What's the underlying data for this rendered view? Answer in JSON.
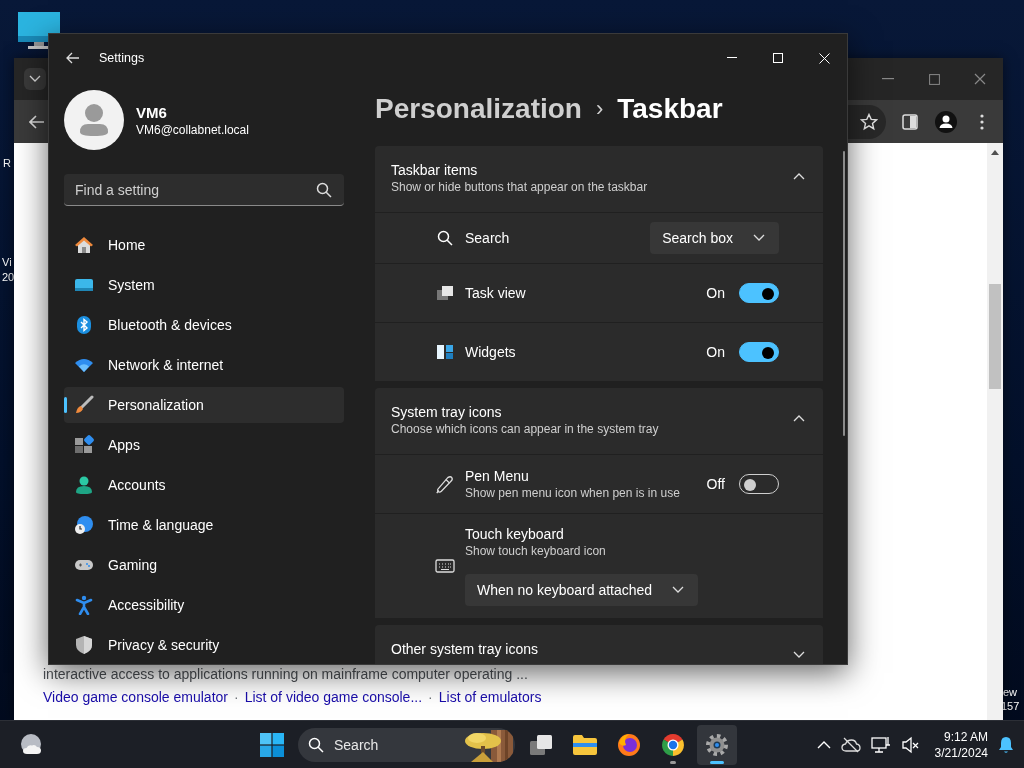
{
  "desktop": {
    "edge_texts": [
      "R",
      "Vi",
      "20",
      "ew",
      "157"
    ]
  },
  "browser": {
    "result": {
      "snippet": "interactive access to applications running on mainframe computer operating ...",
      "separator": "·",
      "links": [
        "Video game console emulator",
        "List of video game console...",
        "List of emulators"
      ]
    }
  },
  "settings": {
    "title": "Settings",
    "user": {
      "name": "VM6",
      "email": "VM6@collabnet.local"
    },
    "search": {
      "placeholder": "Find a setting"
    },
    "nav": [
      {
        "label": "Home",
        "selected": false
      },
      {
        "label": "System",
        "selected": false
      },
      {
        "label": "Bluetooth & devices",
        "selected": false
      },
      {
        "label": "Network & internet",
        "selected": false
      },
      {
        "label": "Personalization",
        "selected": true
      },
      {
        "label": "Apps",
        "selected": false
      },
      {
        "label": "Accounts",
        "selected": false
      },
      {
        "label": "Time & language",
        "selected": false
      },
      {
        "label": "Gaming",
        "selected": false
      },
      {
        "label": "Accessibility",
        "selected": false
      },
      {
        "label": "Privacy & security",
        "selected": false
      }
    ],
    "breadcrumb": {
      "parent": "Personalization",
      "separator": "›",
      "current": "Taskbar"
    },
    "sections": [
      {
        "title": "Taskbar items",
        "subtitle": "Show or hide buttons that appear on the taskbar",
        "expanded": true,
        "rows": [
          {
            "kind": "dropdown",
            "label": "Search",
            "value": "Search box"
          },
          {
            "kind": "toggle",
            "label": "Task view",
            "state_text": "On",
            "on": true
          },
          {
            "kind": "toggle",
            "label": "Widgets",
            "state_text": "On",
            "on": true
          }
        ]
      },
      {
        "title": "System tray icons",
        "subtitle": "Choose which icons can appear in the system tray",
        "expanded": true,
        "rows": [
          {
            "kind": "toggle",
            "label": "Pen Menu",
            "description": "Show pen menu icon when pen is in use",
            "state_text": "Off",
            "on": false
          },
          {
            "kind": "dropdown-below",
            "label": "Touch keyboard",
            "description": "Show touch keyboard icon",
            "value": "When no keyboard attached"
          }
        ]
      },
      {
        "title": "Other system tray icons",
        "expanded": false
      }
    ]
  },
  "taskbar": {
    "search": {
      "placeholder": "Search"
    },
    "apps": [
      {
        "running": false,
        "selected": false
      },
      {
        "running": false,
        "selected": false
      },
      {
        "running": false,
        "selected": false
      },
      {
        "running": true,
        "selected": false
      },
      {
        "running": true,
        "selected": true
      }
    ],
    "clock": {
      "time": "9:12 AM",
      "date": "3/21/2024"
    }
  }
}
